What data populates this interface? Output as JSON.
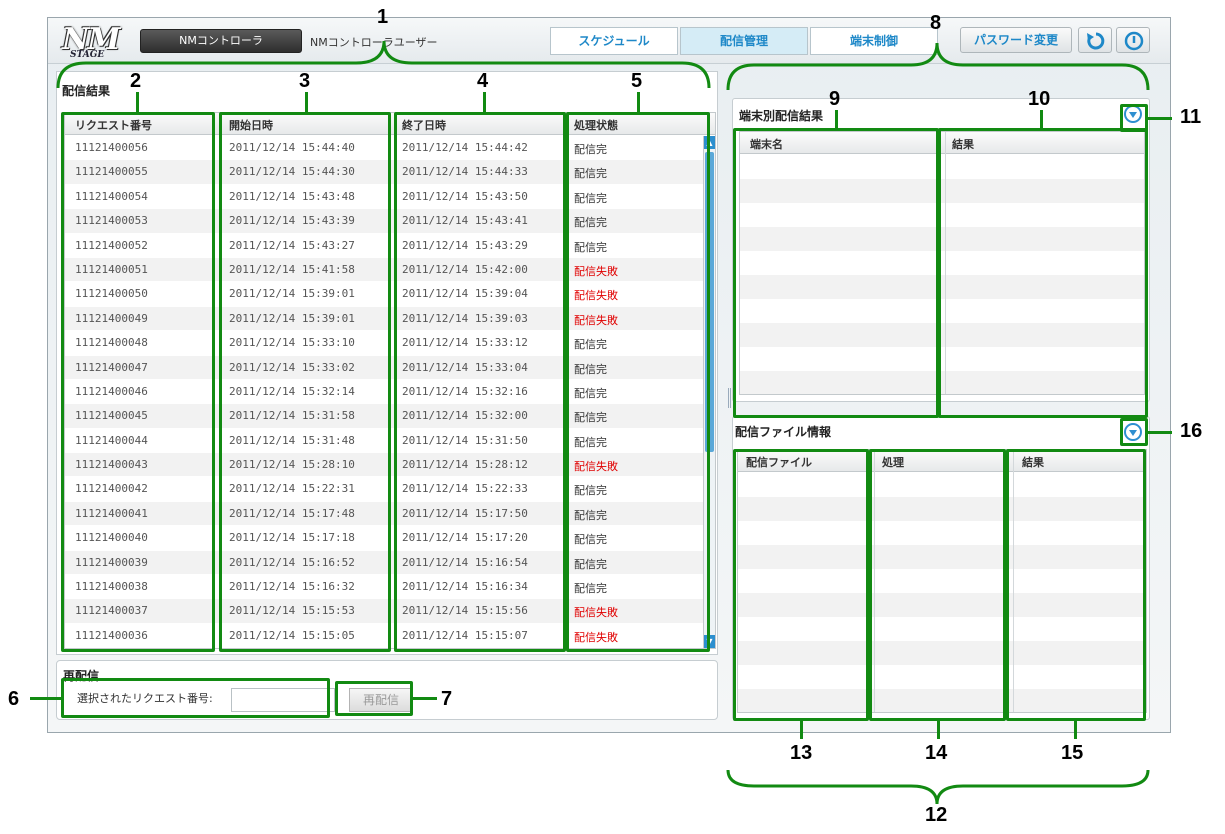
{
  "header": {
    "logo_text": "NM",
    "logo_sub": "STAGE",
    "controller_label": "NMコントローラ",
    "user_label": "NMコントローラユーザー",
    "tabs": [
      {
        "label": "スケジュール",
        "active": false
      },
      {
        "label": "配信管理",
        "active": true
      },
      {
        "label": "端末制御",
        "active": false
      }
    ],
    "password_button": "パスワード変更",
    "refresh_icon": "refresh-icon",
    "info_icon": "power-icon"
  },
  "results_panel": {
    "title": "配信結果",
    "columns": [
      "リクエスト番号",
      "開始日時",
      "終了日時",
      "処理状態"
    ],
    "rows": [
      [
        "11121400056",
        "2011/12/14 15:44:40",
        "2011/12/14 15:44:42",
        "配信完"
      ],
      [
        "11121400055",
        "2011/12/14 15:44:30",
        "2011/12/14 15:44:33",
        "配信完"
      ],
      [
        "11121400054",
        "2011/12/14 15:43:48",
        "2011/12/14 15:43:50",
        "配信完"
      ],
      [
        "11121400053",
        "2011/12/14 15:43:39",
        "2011/12/14 15:43:41",
        "配信完"
      ],
      [
        "11121400052",
        "2011/12/14 15:43:27",
        "2011/12/14 15:43:29",
        "配信完"
      ],
      [
        "11121400051",
        "2011/12/14 15:41:58",
        "2011/12/14 15:42:00",
        "配信失敗"
      ],
      [
        "11121400050",
        "2011/12/14 15:39:01",
        "2011/12/14 15:39:04",
        "配信失敗"
      ],
      [
        "11121400049",
        "2011/12/14 15:39:01",
        "2011/12/14 15:39:03",
        "配信失敗"
      ],
      [
        "11121400048",
        "2011/12/14 15:33:10",
        "2011/12/14 15:33:12",
        "配信完"
      ],
      [
        "11121400047",
        "2011/12/14 15:33:02",
        "2011/12/14 15:33:04",
        "配信完"
      ],
      [
        "11121400046",
        "2011/12/14 15:32:14",
        "2011/12/14 15:32:16",
        "配信完"
      ],
      [
        "11121400045",
        "2011/12/14 15:31:58",
        "2011/12/14 15:32:00",
        "配信完"
      ],
      [
        "11121400044",
        "2011/12/14 15:31:48",
        "2011/12/14 15:31:50",
        "配信完"
      ],
      [
        "11121400043",
        "2011/12/14 15:28:10",
        "2011/12/14 15:28:12",
        "配信失敗"
      ],
      [
        "11121400042",
        "2011/12/14 15:22:31",
        "2011/12/14 15:22:33",
        "配信完"
      ],
      [
        "11121400041",
        "2011/12/14 15:17:48",
        "2011/12/14 15:17:50",
        "配信完"
      ],
      [
        "11121400040",
        "2011/12/14 15:17:18",
        "2011/12/14 15:17:20",
        "配信完"
      ],
      [
        "11121400039",
        "2011/12/14 15:16:52",
        "2011/12/14 15:16:54",
        "配信完"
      ],
      [
        "11121400038",
        "2011/12/14 15:16:32",
        "2011/12/14 15:16:34",
        "配信完"
      ],
      [
        "11121400037",
        "2011/12/14 15:15:53",
        "2011/12/14 15:15:56",
        "配信失敗"
      ],
      [
        "11121400036",
        "2011/12/14 15:15:05",
        "2011/12/14 15:15:07",
        "配信失敗"
      ]
    ],
    "fail_color": "#e00000"
  },
  "redeliver": {
    "title": "再配信",
    "field_label": "選択されたリクエスト番号:",
    "field_value": "",
    "button_label": "再配信"
  },
  "terminal_results": {
    "title": "端末別配信結果",
    "columns": [
      "端末名",
      "結果"
    ]
  },
  "file_info": {
    "title": "配信ファイル情報",
    "columns": [
      "配信ファイル",
      "処理",
      "結果"
    ]
  },
  "callouts": [
    "1",
    "2",
    "3",
    "4",
    "5",
    "6",
    "7",
    "8",
    "9",
    "10",
    "11",
    "12",
    "13",
    "14",
    "15",
    "16"
  ],
  "annotation_color": "#128a12"
}
